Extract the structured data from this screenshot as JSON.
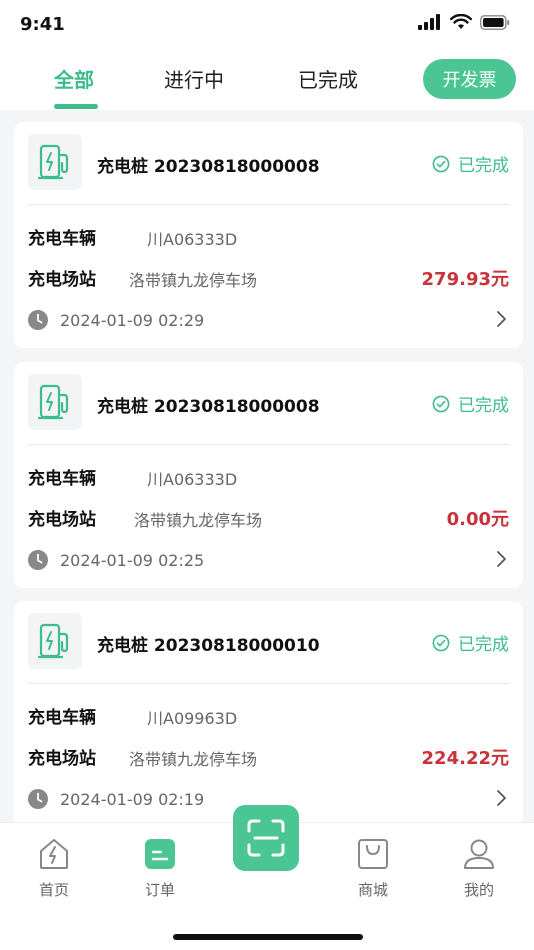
{
  "status_bar": {
    "time": "9:41"
  },
  "tabs": [
    {
      "label": "全部",
      "active": true
    },
    {
      "label": "进行中",
      "active": false
    },
    {
      "label": "已完成",
      "active": false
    }
  ],
  "invoice_button": "开发票",
  "orders": [
    {
      "title": "充电桩 20230818000008",
      "status": "已完成",
      "vehicle_label": "充电车辆",
      "vehicle": "川A06333D",
      "station_label": "充电场站",
      "station": "洛带镇九龙停车场",
      "amount": "279.93元",
      "time": "2024-01-09 02:29"
    },
    {
      "title": "充电桩 20230818000008",
      "status": "已完成",
      "vehicle_label": "充电车辆",
      "vehicle": "川A06333D",
      "station_label": "充电场站",
      "station": "洛带镇九龙停车场",
      "amount": "0.00元",
      "time": "2024-01-09 02:25"
    },
    {
      "title": "充电桩 20230818000010",
      "status": "已完成",
      "vehicle_label": "充电车辆",
      "vehicle": "川A09963D",
      "station_label": "充电场站",
      "station": "洛带镇九龙停车场",
      "amount": "224.22元",
      "time": "2024-01-09 02:19"
    }
  ],
  "bottom_nav": [
    {
      "label": "首页",
      "icon": "home-icon"
    },
    {
      "label": "订单",
      "icon": "order-icon"
    },
    {
      "label": "",
      "icon": "scan-icon"
    },
    {
      "label": "商城",
      "icon": "mall-bag-icon"
    },
    {
      "label": "我的",
      "icon": "user-icon"
    }
  ],
  "colors": {
    "accent": "#3dbd8a",
    "amount": "#c8323a"
  }
}
